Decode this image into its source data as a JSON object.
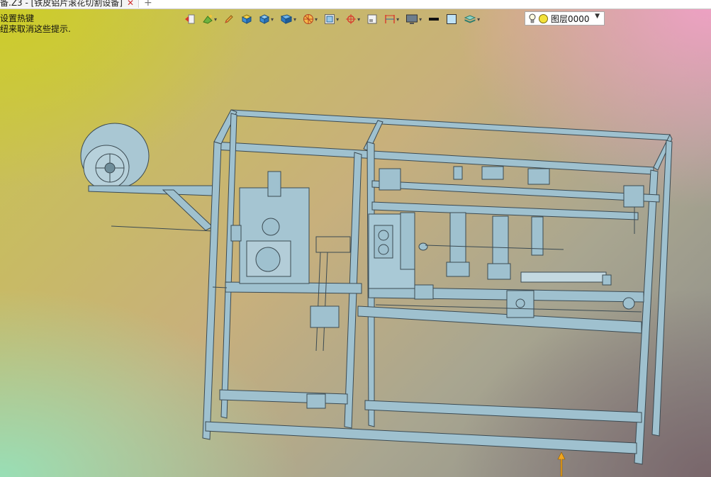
{
  "tab": {
    "title": "备.Z3 - [铁皮铝片滚花切割设备]",
    "close": "✕",
    "add": "+"
  },
  "hint": {
    "line1": "设置热键",
    "line2": "纽来取消这些提示."
  },
  "layer": {
    "name": "图层0000"
  },
  "colors": {
    "model_fill": "#9fc1cf",
    "model_stroke": "#3b4a52"
  },
  "toolbar_icons": [
    "exit-icon",
    "paint-icon",
    "pencil-icon",
    "solid-cube-icon",
    "cube-icon",
    "view-cube-icon",
    "wheel-icon",
    "frame-icon",
    "target-icon",
    "sheet-icon",
    "dimension-icon",
    "monitor-icon",
    "line-color-icon",
    "fill-color-icon",
    "layers-icon"
  ]
}
